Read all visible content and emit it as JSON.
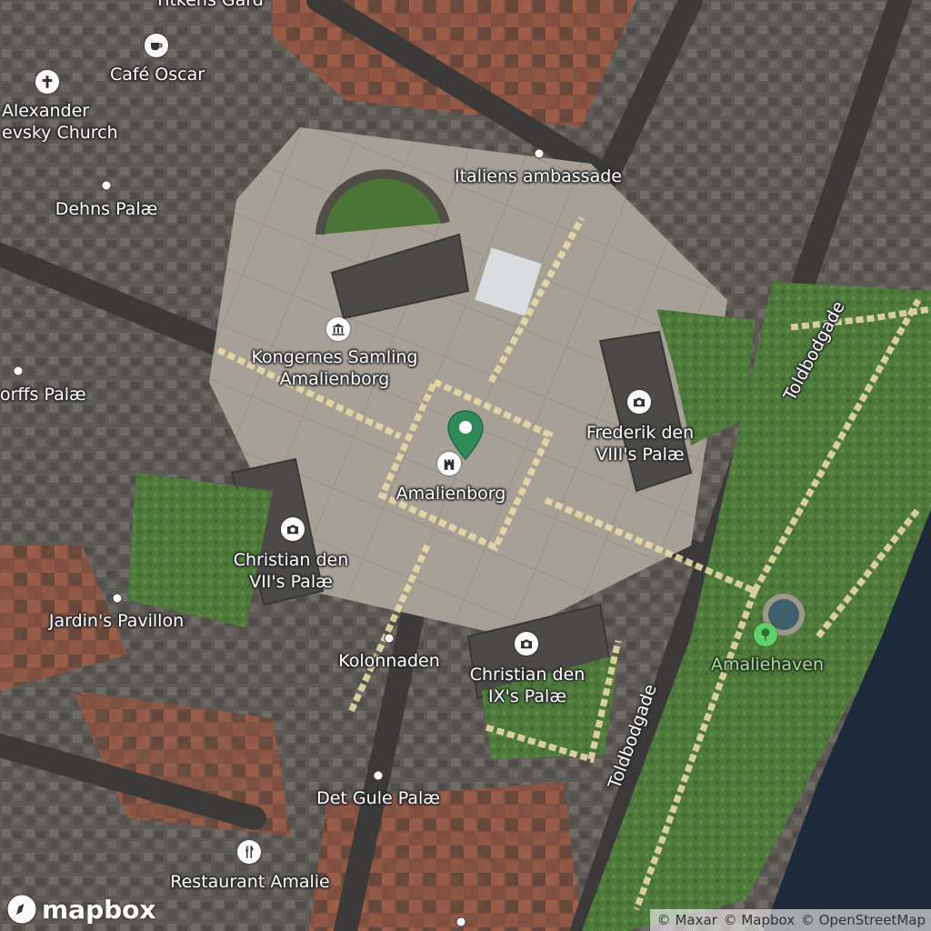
{
  "map": {
    "provider_logo": "mapbox",
    "attribution": [
      "© Maxar",
      "© Mapbox",
      "© OpenStreetMap"
    ],
    "colors": {
      "park_label": "#9be38d",
      "marker": "#2e8a57",
      "poi_park": "#5fd16a",
      "water": "#1d2a3a"
    },
    "labels": {
      "top_cut": "Titkens Gård",
      "cafe": "Café Oscar",
      "church": [
        "Alexander",
        "evsky Church"
      ],
      "embassy": "Italiens ambassade",
      "dehns": "Dehns Palæ",
      "kongernes": [
        "Kongernes Samling",
        "Amalienborg"
      ],
      "moltke": "orffs Palæ",
      "frederik": [
        "Frederik den",
        "VIII's Palæ"
      ],
      "amalienborg": "Amalienborg",
      "christian7": [
        "Christian den",
        "VII's Palæ"
      ],
      "jardin": "Jardin's Pavillon",
      "kolonnaden": "Kolonnaden",
      "christian9": [
        "Christian den",
        "IX's Palæ"
      ],
      "amaliehaven": "Amaliehaven",
      "toldbodgade_a": "Toldbodgade",
      "toldbodgade_b": "Toldbodgade",
      "gule": "Det Gule Palæ",
      "restaurant": "Restaurant Amalie"
    },
    "icons": {
      "cafe": "cafe-cup-icon",
      "church": "church-cross-icon",
      "museum": "museum-icon",
      "castle": "castle-icon",
      "camera": "camera-icon",
      "park": "tree-icon",
      "restaurant": "fork-knife-icon",
      "marker": "location-pin-icon"
    }
  }
}
